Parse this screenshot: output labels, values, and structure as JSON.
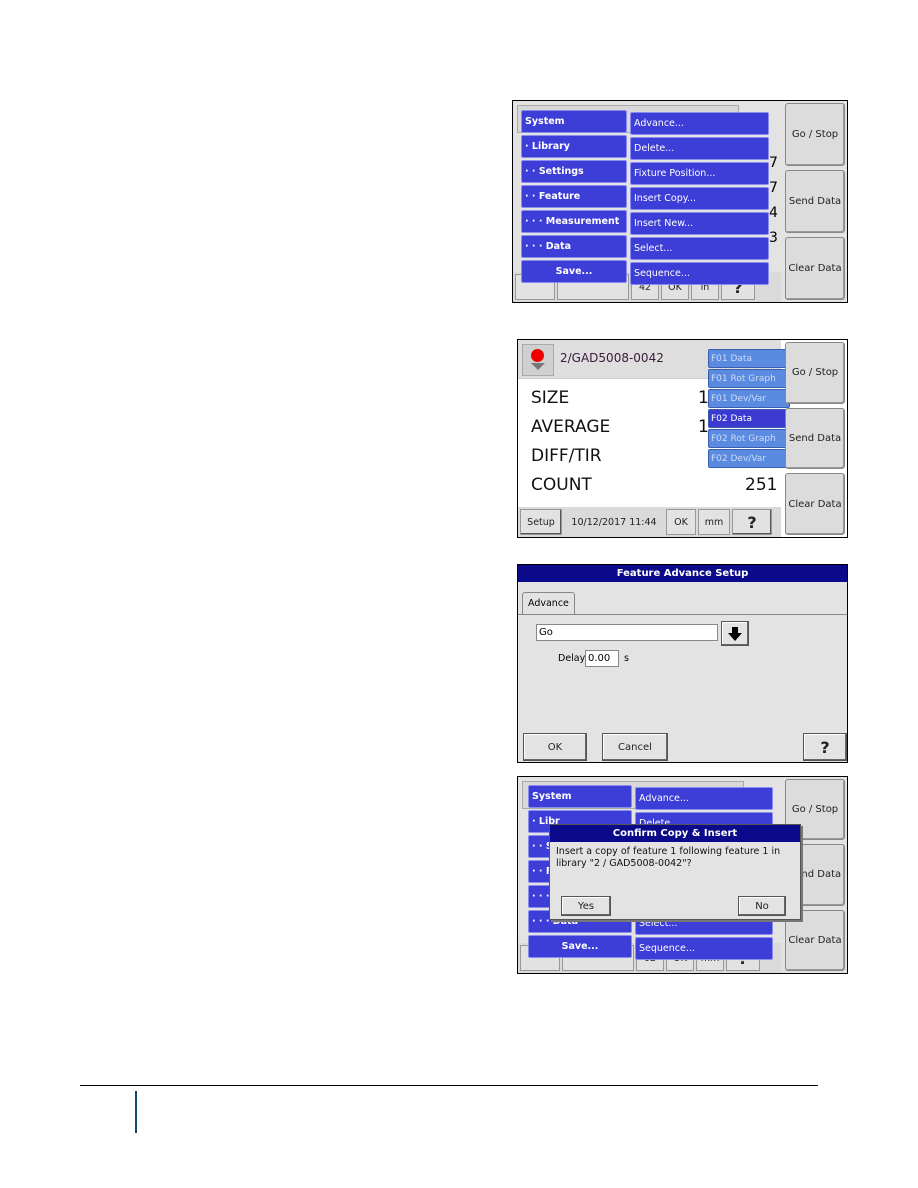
{
  "side_buttons": {
    "go_stop": "Go / Stop",
    "send_data": "Send Data",
    "clear_data": "Clear Data"
  },
  "panel1": {
    "left_menu": [
      {
        "label": "System",
        "align": "left"
      },
      {
        "label": "· Library",
        "align": "left"
      },
      {
        "label": "· · Settings",
        "align": "left"
      },
      {
        "label": "· · Feature",
        "align": "left"
      },
      {
        "label": "· · · Measurement",
        "align": "left"
      },
      {
        "label": "· · · Data",
        "align": "left"
      },
      {
        "label": "Save...",
        "align": "center"
      }
    ],
    "right_menu": [
      "Advance...",
      "Delete...",
      "Fixture Position...",
      "Insert Copy...",
      "Insert New...",
      "Select...",
      "Sequence..."
    ],
    "peek_digits": [
      "7",
      "7",
      "4",
      "3"
    ],
    "bottom_partial": [
      "42",
      "OK",
      "in"
    ]
  },
  "panel2": {
    "library": "2/GAD5008-0042",
    "labels": [
      "SIZE",
      "AVERAGE",
      "DIFF/TIR",
      "COUNT"
    ],
    "values": [
      "1",
      "1",
      "",
      "251"
    ],
    "float_menu": [
      {
        "label": "F01 Data",
        "active": false
      },
      {
        "label": "F01 Rot Graph",
        "active": false
      },
      {
        "label": "F01 Dev/Var",
        "active": false
      },
      {
        "label": "F02 Data",
        "active": true
      },
      {
        "label": "F02 Rot Graph",
        "active": false
      },
      {
        "label": "F02 Dev/Var",
        "active": false
      }
    ],
    "bottom": {
      "setup": "Setup",
      "datetime": "10/12/2017 11:44",
      "status": "OK",
      "units": "mm"
    }
  },
  "panel3": {
    "title": "Feature Advance Setup",
    "tab": "Advance",
    "mode_value": "Go",
    "delay_label": "Delay",
    "delay_value": "0.00",
    "delay_unit": "s",
    "ok": "OK",
    "cancel": "Cancel"
  },
  "panel4": {
    "left_menu": [
      "System",
      "· Libr",
      "· · Se",
      "· · Fe",
      "· · · M",
      "· · · Data",
      "Save..."
    ],
    "right_menu": [
      "Advance...",
      "Delete...",
      "",
      "",
      "",
      "Select...",
      "Sequence..."
    ],
    "dialog": {
      "title": "Confirm Copy & Insert",
      "message": "Insert a copy of feature 1 following feature 1 in library \"2 / GAD5008-0042\"?",
      "yes": "Yes",
      "no": "No"
    },
    "bottom_partial": [
      "02",
      "OK",
      "mm"
    ]
  },
  "help_glyph": "?"
}
